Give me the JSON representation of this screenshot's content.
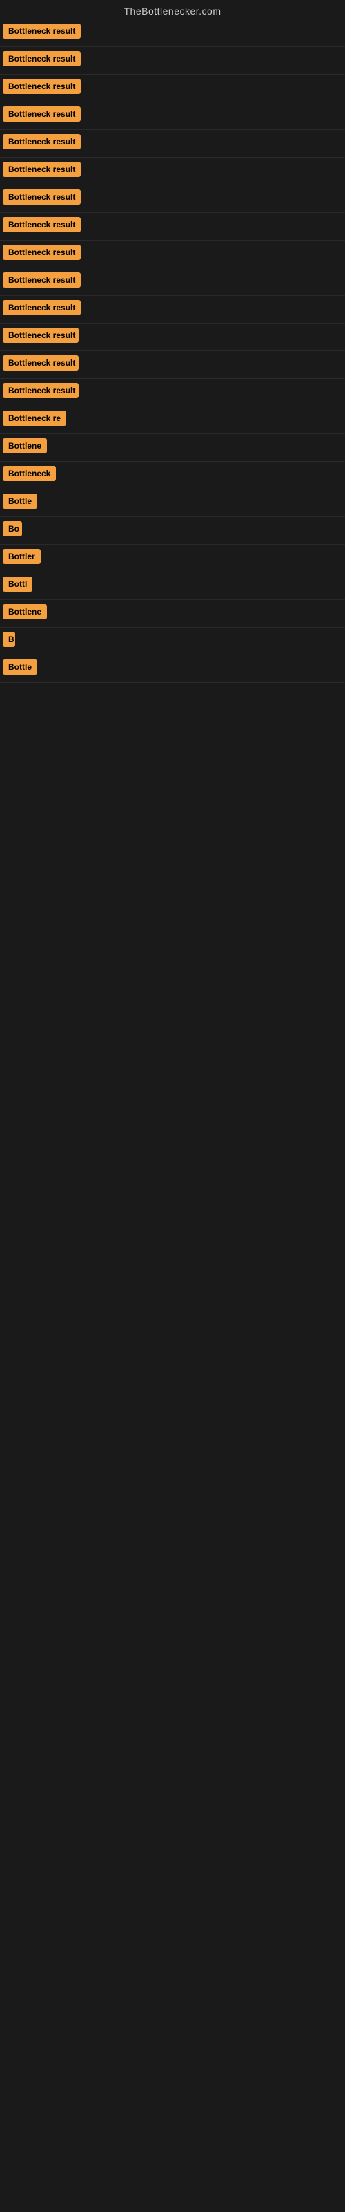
{
  "site": {
    "title": "TheBottlenecker.com"
  },
  "results": [
    {
      "id": 1,
      "label": "Bottleneck result",
      "width": 120
    },
    {
      "id": 2,
      "label": "Bottleneck result",
      "width": 120
    },
    {
      "id": 3,
      "label": "Bottleneck result",
      "width": 120
    },
    {
      "id": 4,
      "label": "Bottleneck result",
      "width": 120
    },
    {
      "id": 5,
      "label": "Bottleneck result",
      "width": 120
    },
    {
      "id": 6,
      "label": "Bottleneck result",
      "width": 120
    },
    {
      "id": 7,
      "label": "Bottleneck result",
      "width": 120
    },
    {
      "id": 8,
      "label": "Bottleneck result",
      "width": 120
    },
    {
      "id": 9,
      "label": "Bottleneck result",
      "width": 120
    },
    {
      "id": 10,
      "label": "Bottleneck result",
      "width": 120
    },
    {
      "id": 11,
      "label": "Bottleneck result",
      "width": 120
    },
    {
      "id": 12,
      "label": "Bottleneck result",
      "width": 110
    },
    {
      "id": 13,
      "label": "Bottleneck result",
      "width": 110
    },
    {
      "id": 14,
      "label": "Bottleneck result",
      "width": 110
    },
    {
      "id": 15,
      "label": "Bottleneck re",
      "width": 95
    },
    {
      "id": 16,
      "label": "Bottlene",
      "width": 75
    },
    {
      "id": 17,
      "label": "Bottleneck",
      "width": 80
    },
    {
      "id": 18,
      "label": "Bottle",
      "width": 60
    },
    {
      "id": 19,
      "label": "Bo",
      "width": 28
    },
    {
      "id": 20,
      "label": "Bottler",
      "width": 58
    },
    {
      "id": 21,
      "label": "Bottl",
      "width": 48
    },
    {
      "id": 22,
      "label": "Bottlene",
      "width": 68
    },
    {
      "id": 23,
      "label": "B",
      "width": 18
    },
    {
      "id": 24,
      "label": "Bottle",
      "width": 55
    }
  ]
}
